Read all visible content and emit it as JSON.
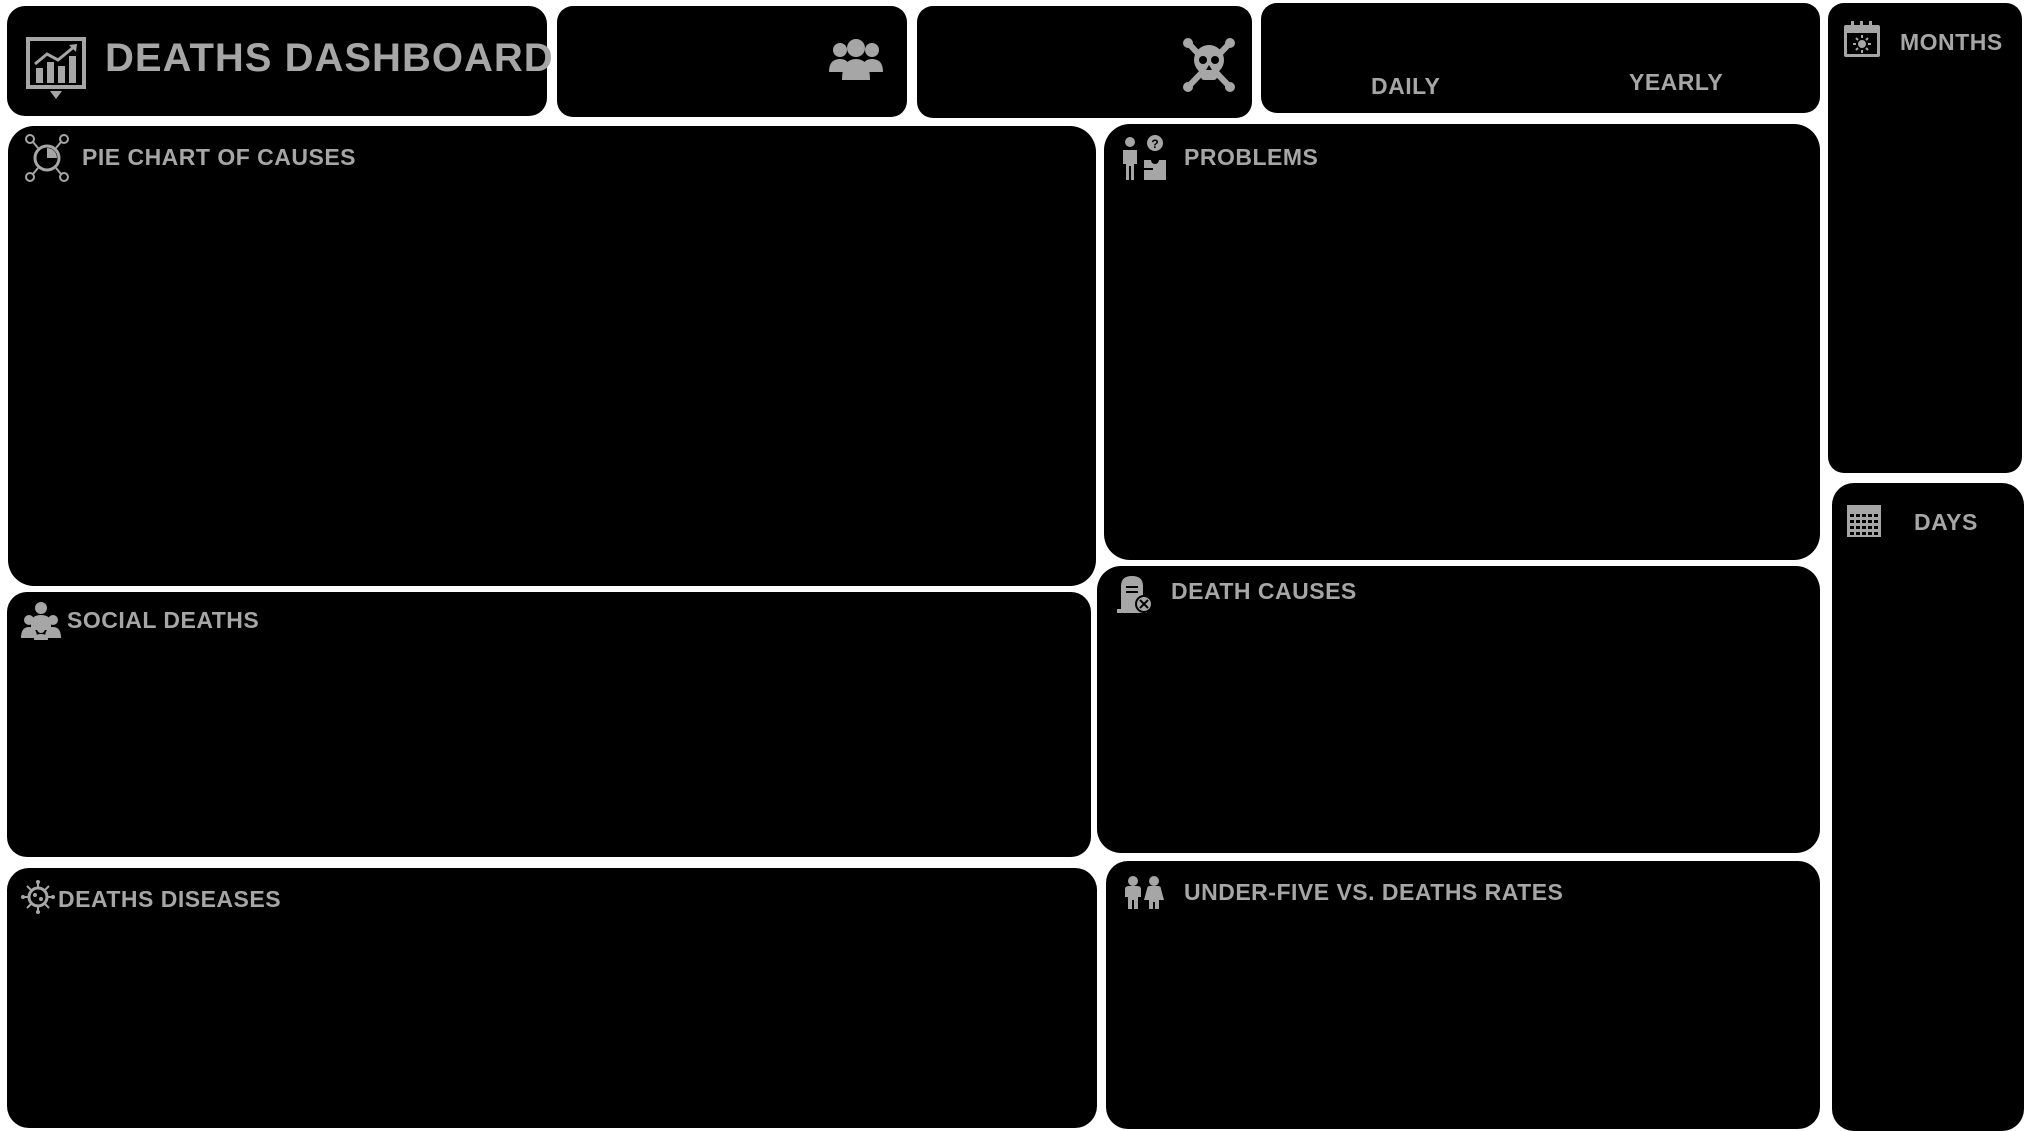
{
  "header": {
    "title": "DEATHS DASHBOARD",
    "title_icon": "chart-growth-icon"
  },
  "kpis": {
    "people_icon": "people-group-icon",
    "skull_icon": "skull-crossbones-icon"
  },
  "toggle": {
    "daily_label": "DAILY",
    "yearly_label": "YEARLY"
  },
  "panels": {
    "pie_chart": {
      "title": "PIE CHART OF CAUSES",
      "icon": "pie-chart-icon"
    },
    "problems": {
      "title": "PROBLEMS",
      "icon": "person-puzzle-icon"
    },
    "social_deaths": {
      "title": "SOCIAL DEATHS",
      "icon": "crowd-icon"
    },
    "death_causes": {
      "title": "DEATH CAUSES",
      "icon": "tombstone-icon"
    },
    "deaths_diseases": {
      "title": "DEATHS DISEASES",
      "icon": "virus-icon"
    },
    "under_five": {
      "title": "UNDER-FIVE VS. DEATHS RATES",
      "icon": "children-icon"
    }
  },
  "slicers": {
    "months": {
      "title": "MONTHS",
      "icon": "calendar-sun-icon"
    },
    "days": {
      "title": "DAYS",
      "icon": "calendar-grid-icon"
    }
  },
  "colors": {
    "background": "#ffffff",
    "panel": "#000000",
    "text": "#a6a6a6"
  }
}
